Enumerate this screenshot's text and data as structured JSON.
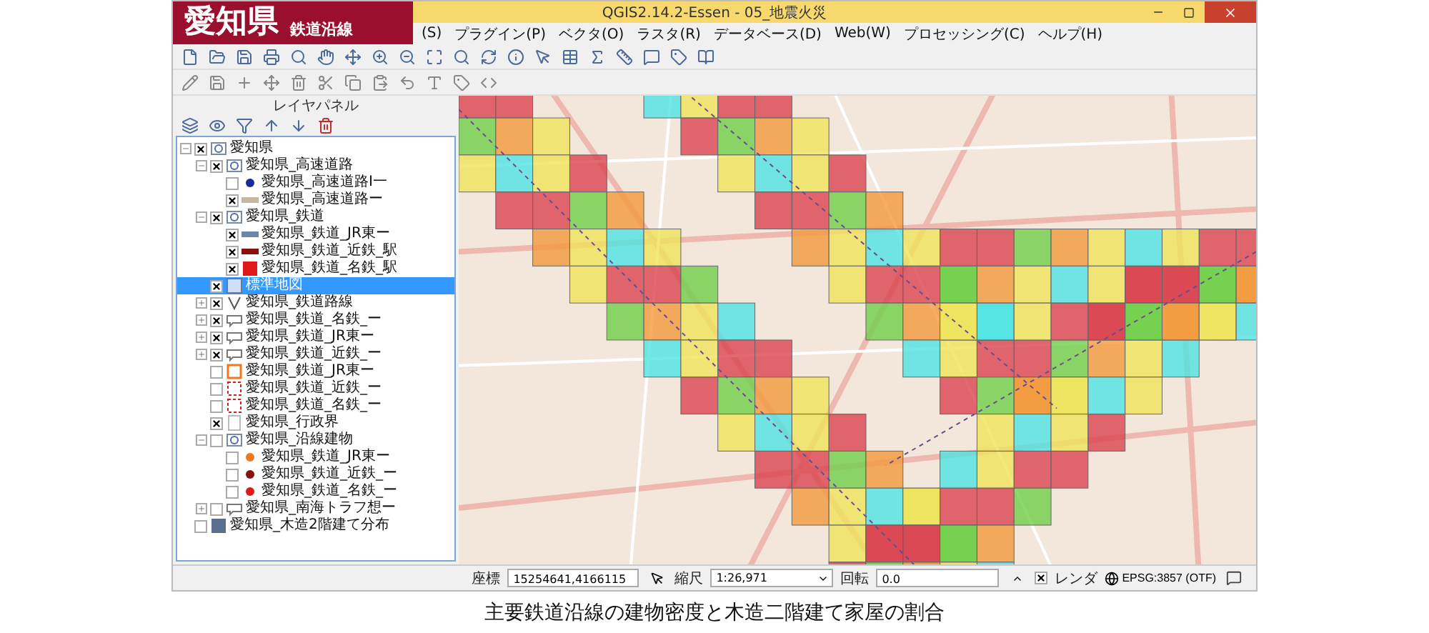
{
  "badge": {
    "title": "愛知県",
    "subtitle": "鉄道沿線"
  },
  "window": {
    "title": "QGIS2.14.2-Essen - 05_地震火災"
  },
  "menu": [
    "(S)",
    "プラグイン(P)",
    "ベクタ(O)",
    "ラスタ(R)",
    "データベース(D)",
    "Web(W)",
    "プロセッシング(C)",
    "ヘルプ(H)"
  ],
  "layers_panel": {
    "title": "レイヤパネル",
    "items": [
      {
        "label": "愛知県",
        "checked": true,
        "expanded": true,
        "selected": false,
        "kind": "group",
        "children": [
          {
            "label": "愛知県_高速道路",
            "checked": true,
            "expanded": true,
            "selected": false,
            "kind": "group",
            "children": [
              {
                "label": "愛知県_高速道路I一",
                "checked": false,
                "selected": false,
                "kind": "dot",
                "color": "#1a2a9a"
              },
              {
                "label": "愛知県_高速道路ー",
                "checked": true,
                "selected": false,
                "kind": "line",
                "color": "#c8b7a0"
              }
            ]
          },
          {
            "label": "愛知県_鉄道",
            "checked": true,
            "expanded": true,
            "selected": false,
            "kind": "group",
            "children": [
              {
                "label": "愛知県_鉄道_JR東ー",
                "checked": true,
                "selected": false,
                "kind": "line",
                "color": "#6a86a8"
              },
              {
                "label": "愛知県_鉄道_近鉄_駅",
                "checked": true,
                "selected": false,
                "kind": "line",
                "color": "#8a1010"
              },
              {
                "label": "愛知県_鉄道_名鉄_駅",
                "checked": true,
                "selected": false,
                "kind": "square",
                "color": "#e01818"
              }
            ]
          },
          {
            "label": "標準地図",
            "checked": true,
            "selected": true,
            "kind": "raster"
          },
          {
            "label": "愛知県_鉄道路線",
            "checked": true,
            "expanded": false,
            "selected": false,
            "kind": "rule"
          },
          {
            "label": "愛知県_鉄道_名鉄_ー",
            "checked": true,
            "expanded": false,
            "selected": false,
            "kind": "label"
          },
          {
            "label": "愛知県_鉄道_JR東ー",
            "checked": true,
            "expanded": false,
            "selected": false,
            "kind": "label"
          },
          {
            "label": "愛知県_鉄道_近鉄_ー",
            "checked": true,
            "expanded": false,
            "selected": false,
            "kind": "label"
          },
          {
            "label": "愛知県_鉄道_JR東ー",
            "checked": false,
            "selected": false,
            "kind": "outline",
            "color": "#f07820"
          },
          {
            "label": "愛知県_鉄道_近鉄_ー",
            "checked": false,
            "selected": false,
            "kind": "dashed",
            "color": "#d02020"
          },
          {
            "label": "愛知県_鉄道_名鉄_ー",
            "checked": false,
            "selected": false,
            "kind": "dashed",
            "color": "#d02020"
          },
          {
            "label": "愛知県_行政界",
            "checked": true,
            "selected": false,
            "kind": "blank"
          },
          {
            "label": "愛知県_沿線建物",
            "checked": false,
            "expanded": true,
            "selected": false,
            "kind": "group",
            "children": [
              {
                "label": "愛知県_鉄道_JR東ー",
                "checked": false,
                "selected": false,
                "kind": "dot",
                "color": "#f07820"
              },
              {
                "label": "愛知県_鉄道_近鉄_ー",
                "checked": false,
                "selected": false,
                "kind": "dot",
                "color": "#8a1010"
              },
              {
                "label": "愛知県_鉄道_名鉄_ー",
                "checked": false,
                "selected": false,
                "kind": "dot",
                "color": "#e01818"
              }
            ]
          },
          {
            "label": "愛知県_南海トラフ想ー",
            "checked": false,
            "expanded": false,
            "selected": false,
            "kind": "label"
          }
        ]
      },
      {
        "label": "愛知県_木造2階建て分布",
        "checked": false,
        "selected": false,
        "kind": "square",
        "color": "#5a6f8e"
      }
    ]
  },
  "status_bar": {
    "coordinate_label": "座標",
    "coordinate": "15254641,4166115",
    "scale_label": "縮尺",
    "scale": "1:26,971",
    "rotation_label": "回転",
    "rotation": "0.0",
    "render_label": "レンダ",
    "render_checked": true,
    "crs": "EPSG:3857 (OTF)"
  },
  "caption": "主要鉄道沿線の建物密度と木造二階建て家屋の割合"
}
